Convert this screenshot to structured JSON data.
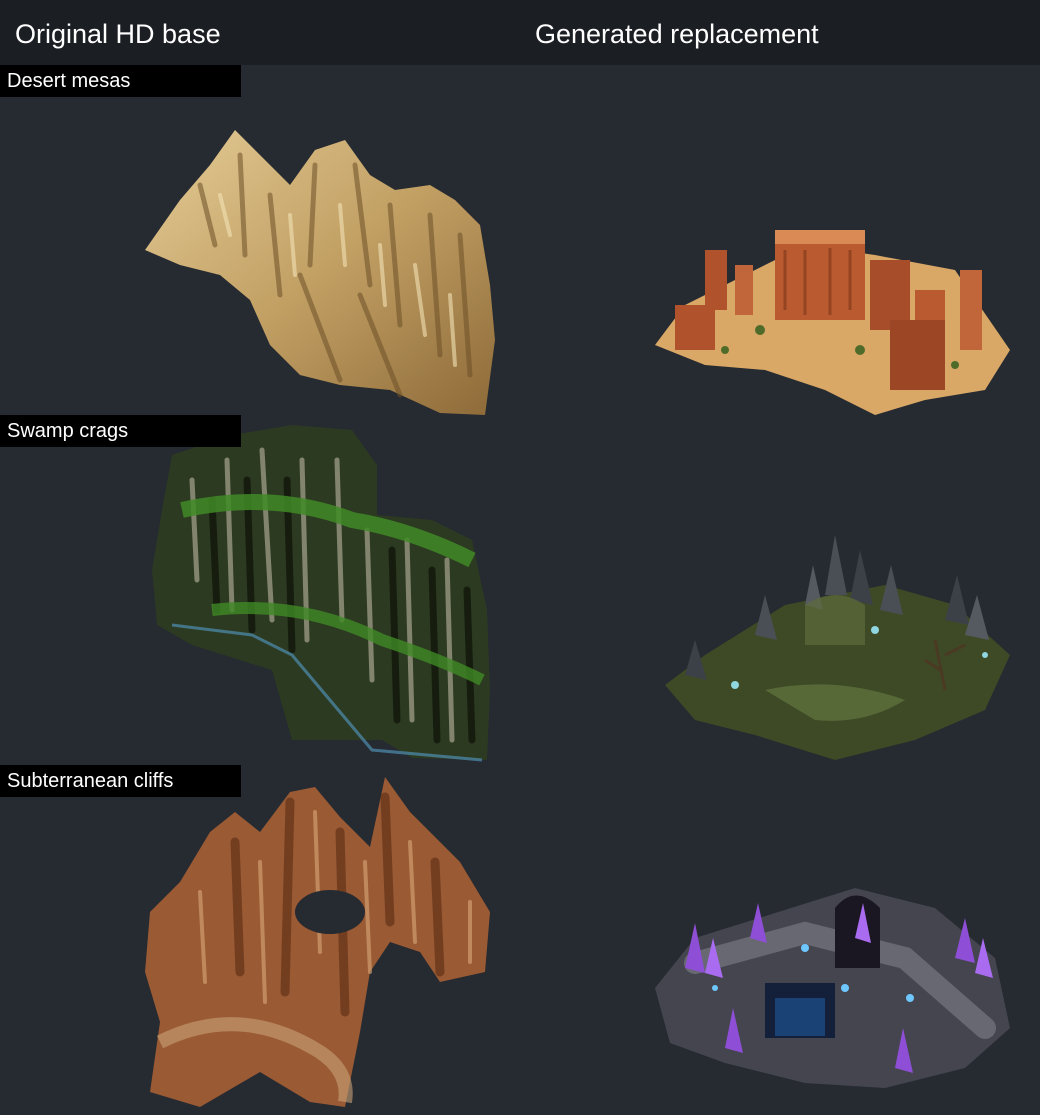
{
  "header": {
    "left_title": "Original HD base",
    "right_title": "Generated replacement"
  },
  "rows": [
    {
      "label": "Desert mesas"
    },
    {
      "label": "Swamp crags"
    },
    {
      "label": "Subterranean cliffs"
    }
  ],
  "colors": {
    "page_background": "#262a31",
    "header_background": "#1b1e23",
    "label_background": "#000000",
    "desert_original": "#c9a96e",
    "desert_generated": "#c8683a",
    "swamp_original": "#3f6b2a",
    "swamp_generated": "#4d5a2c",
    "cave_original": "#9a5a34",
    "cave_generated": "#8e4ed6"
  },
  "icons": [
    "desert-original-sprite",
    "desert-generated-sprite",
    "swamp-original-sprite",
    "swamp-generated-sprite",
    "cave-original-sprite",
    "cave-generated-sprite"
  ]
}
